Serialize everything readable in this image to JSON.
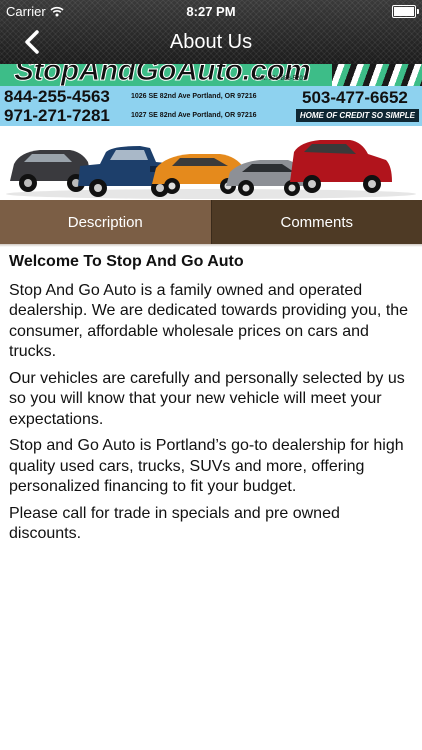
{
  "status_bar": {
    "carrier": "Carrier",
    "time": "8:27 PM"
  },
  "nav": {
    "title": "About Us",
    "back_icon": "chevron-left-icon"
  },
  "banner": {
    "logo_text": "StopAndGoAuto.com",
    "fax": "FAX: 971-888-5201",
    "phone_1": "844-255-4563",
    "address_1": "1026 SE 82nd Ave Portland, OR 97216",
    "phone_2": "971-271-7281",
    "address_2": "1027 SE 82nd Ave Portland, OR 97216",
    "phone_3": "503-477-6652",
    "slogan": "HOME OF CREDIT SO SIMPLE"
  },
  "tabs": [
    {
      "label": "Description",
      "selected": true
    },
    {
      "label": "Comments",
      "selected": false
    }
  ],
  "content": {
    "heading": "Welcome To Stop And Go Auto",
    "paragraphs": [
      "Stop And Go Auto is a family owned and operated dealership. We are dedicated towards providing you, the consumer, affordable wholesale prices on cars and trucks.",
      "Our vehicles are carefully and personally selected by us so you will know that your new vehicle will meet your expectations.",
      "Stop and Go Auto is Portland’s go-to dealership for high quality used cars, trucks, SUVs and more, offering personalized financing to fit your budget.",
      "Please call for trade in specials and pre owned discounts."
    ]
  },
  "colors": {
    "tab_selected": "#7b5e45",
    "tab_unselected": "#4e3a25",
    "banner_green": "#3dbd88",
    "banner_blue": "#8ed2ef"
  }
}
